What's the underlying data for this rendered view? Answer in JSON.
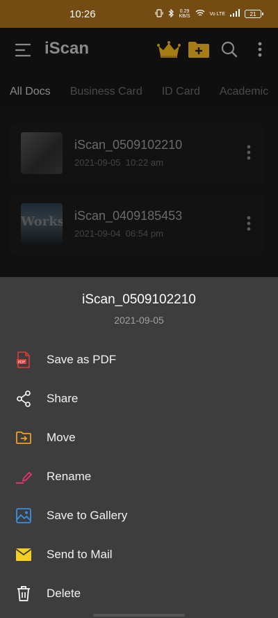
{
  "status_bar": {
    "time": "10:26",
    "speed_value": "0.29",
    "speed_unit": "KB/S",
    "network": "Vo LTE",
    "battery": "21"
  },
  "app_bar": {
    "title": "iScan"
  },
  "tabs": [
    {
      "label": "All Docs",
      "active": true
    },
    {
      "label": "Business Card",
      "active": false
    },
    {
      "label": "ID Card",
      "active": false
    },
    {
      "label": "Academic",
      "active": false
    }
  ],
  "documents": [
    {
      "name": "iScan_0509102210",
      "date": "2021-09-05",
      "time": "10:22 am"
    },
    {
      "name": "iScan_0409185453",
      "date": "2021-09-04",
      "time": "06:54 pm",
      "thumb_text": "Works®"
    }
  ],
  "sheet": {
    "title": "iScan_0509102210",
    "date": "2021-09-05",
    "actions": [
      {
        "label": "Save as PDF",
        "icon": "pdf-icon",
        "color": "#e03a3a"
      },
      {
        "label": "Share",
        "icon": "share-icon",
        "color": "#ffffff"
      },
      {
        "label": "Move",
        "icon": "move-folder-icon",
        "color": "#f0a020"
      },
      {
        "label": "Rename",
        "icon": "pencil-icon",
        "color": "#e8336a"
      },
      {
        "label": "Save to Gallery",
        "icon": "gallery-icon",
        "color": "#3a8fe0"
      },
      {
        "label": "Send to Mail",
        "icon": "mail-icon",
        "color": "#f5d020"
      },
      {
        "label": "Delete",
        "icon": "trash-icon",
        "color": "#ffffff"
      }
    ]
  },
  "colors": {
    "status_bar": "#744b12",
    "sheet_background": "#3d3d3d",
    "accent": "#c79a1e"
  }
}
